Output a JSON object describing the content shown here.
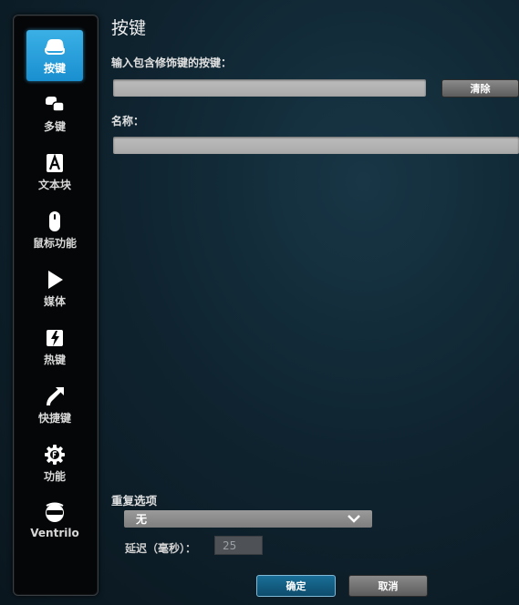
{
  "sidebar": {
    "items": [
      {
        "label": "按键",
        "icon": "keystroke-icon",
        "active": true
      },
      {
        "label": "多键",
        "icon": "multikey-icon"
      },
      {
        "label": "文本块",
        "icon": "text-block-icon"
      },
      {
        "label": "鼠标功能",
        "icon": "mouse-icon"
      },
      {
        "label": "媒体",
        "icon": "media-play-icon"
      },
      {
        "label": "热键",
        "icon": "hotkey-icon"
      },
      {
        "label": "快捷键",
        "icon": "shortcut-arrow-icon"
      },
      {
        "label": "功能",
        "icon": "function-gear-icon"
      },
      {
        "label": "Ventrilo",
        "icon": "ventrilo-icon"
      }
    ]
  },
  "main": {
    "title": "按键",
    "keystroke_label": "输入包含修饰键的按键：",
    "keystroke_value": "",
    "clear_button": "清除",
    "name_label": "名称：",
    "name_value": "",
    "repeat_label": "重复选项",
    "repeat_selected": "无",
    "delay_label": "延迟（毫秒）：",
    "delay_value": "25",
    "ok_button": "确定",
    "cancel_button": "取消"
  },
  "colors": {
    "accent": "#2aa0dc",
    "background": "#0f2430"
  }
}
